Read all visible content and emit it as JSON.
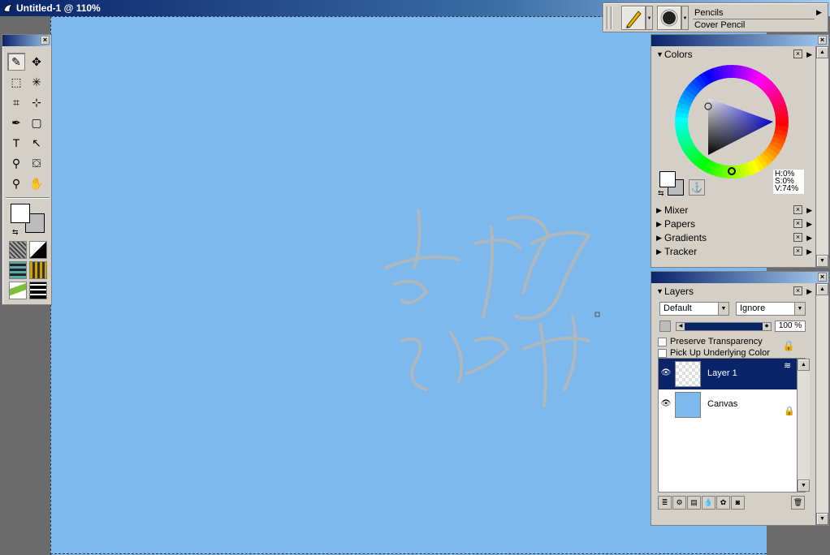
{
  "window": {
    "title": "Untitled-1 @ 110%"
  },
  "property_bar": {
    "brush_category": "Pencils",
    "brush_variant": "Cover Pencil"
  },
  "toolbox": {
    "tools": [
      {
        "name": "brush-tool",
        "glyph": "✎"
      },
      {
        "name": "layer-adjuster-tool",
        "glyph": "✥"
      },
      {
        "name": "rectangular-selection-tool",
        "glyph": "⬚"
      },
      {
        "name": "magic-wand-tool",
        "glyph": "✳"
      },
      {
        "name": "crop-tool",
        "glyph": "⌗"
      },
      {
        "name": "selection-adjuster-tool",
        "glyph": "⊹"
      },
      {
        "name": "pen-tool",
        "glyph": "✒"
      },
      {
        "name": "rectangle-shape-tool",
        "glyph": "▢"
      },
      {
        "name": "text-tool",
        "glyph": "T"
      },
      {
        "name": "shape-selection-tool",
        "glyph": "↖"
      },
      {
        "name": "dropper-tool",
        "glyph": "⚲"
      },
      {
        "name": "paint-bucket-tool",
        "glyph": "⛋"
      },
      {
        "name": "magnifier-tool",
        "glyph": "⚲"
      },
      {
        "name": "grabber-tool",
        "glyph": "✋"
      }
    ],
    "colors": {
      "primary": "#ffffff",
      "secondary": "#bcbcbc"
    }
  },
  "colors_panel": {
    "title": "Colors",
    "hsv": {
      "h": "H:0%",
      "s": "S:0%",
      "v": "V:74%"
    }
  },
  "collapsed_sections": [
    "Mixer",
    "Papers",
    "Gradients",
    "Tracker"
  ],
  "layers_panel": {
    "title": "Layers",
    "composite_method": "Default",
    "composite_depth": "Ignore",
    "opacity": "100 %",
    "preserve_transparency": "Preserve Transparency",
    "pick_up_underlying": "Pick Up Underlying Color",
    "layers": [
      {
        "name": "Layer 1",
        "selected": true
      },
      {
        "name": "Canvas",
        "selected": false
      }
    ]
  },
  "canvas": {
    "color": "#7db9ec"
  }
}
